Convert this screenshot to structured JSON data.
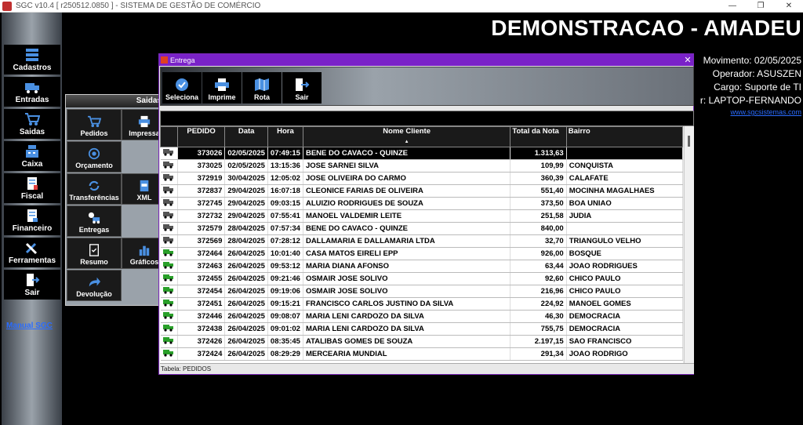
{
  "window": {
    "title": "SGC v10.4 [ r250512.0850 ] - SISTEMA DE GESTÃO DE COMÉRCIO",
    "minimize": "—",
    "maximize": "❐",
    "close": "✕"
  },
  "sidebar": {
    "items": [
      {
        "label": "Cadastros",
        "icon": "server-stack-icon"
      },
      {
        "label": "Entradas",
        "icon": "truck-icon"
      },
      {
        "label": "Saidas",
        "icon": "cart-icon"
      },
      {
        "label": "Caixa",
        "icon": "cash-register-icon"
      },
      {
        "label": "Fiscal",
        "icon": "fiscal-document-icon"
      },
      {
        "label": "Financeiro",
        "icon": "financial-document-icon"
      },
      {
        "label": "Ferramentas",
        "icon": "tools-icon"
      },
      {
        "label": "Sair",
        "icon": "exit-door-icon"
      }
    ],
    "manual_link": "Manual SGC"
  },
  "header": {
    "company": "DEMONSTRACAO - AMADEU",
    "movimento": "Movimento: 02/05/2025",
    "operador": "Operador: ASUSZEN",
    "cargo": "Cargo: Suporte de TI",
    "computador": "r: LAPTOP-FERNANDO",
    "site": "www.sgcsistemas.com"
  },
  "saidas_panel": {
    "title": "Saidas",
    "items": [
      {
        "label": "Pedidos",
        "icon": "cart-icon"
      },
      {
        "label": "Impressa",
        "icon": "printer-icon"
      },
      {
        "label": "Orçamento",
        "icon": "budget-icon"
      },
      {
        "label": "Transferências",
        "icon": "transfer-icon"
      },
      {
        "label": "XML",
        "icon": "xml-icon"
      },
      {
        "label": "Entregas",
        "icon": "delivery-icon"
      },
      {
        "label": "Resumo",
        "icon": "summary-icon"
      },
      {
        "label": "Gráficos",
        "icon": "bar-chart-icon"
      },
      {
        "label": "Devolução",
        "icon": "return-arrow-icon"
      }
    ]
  },
  "dialog": {
    "title": "Entrega",
    "close": "✕",
    "toolbar": [
      {
        "label": "Seleciona",
        "icon": "check-circle-icon"
      },
      {
        "label": "Imprime",
        "icon": "printer-icon"
      },
      {
        "label": "Rota",
        "icon": "map-icon"
      },
      {
        "label": "Sair",
        "icon": "exit-door-icon"
      }
    ],
    "columns": [
      "",
      "PEDIDO",
      "Data",
      "Hora",
      "Nome Cliente",
      "Total da Nota",
      "Bairro"
    ],
    "sort_indicator": "▲",
    "rows": [
      {
        "pedido": "373026",
        "data": "02/05/2025",
        "hora": "07:49:15",
        "cliente": "BENE DO CAVACO - QUINZE",
        "total": "1.313,63",
        "bairro": "",
        "selected": true
      },
      {
        "pedido": "373025",
        "data": "02/05/2025",
        "hora": "13:15:36",
        "cliente": "JOSE SARNEI SILVA",
        "total": "109,99",
        "bairro": "CONQUISTA"
      },
      {
        "pedido": "372919",
        "data": "30/04/2025",
        "hora": "12:05:02",
        "cliente": "JOSE OLIVEIRA DO CARMO",
        "total": "360,39",
        "bairro": "CALAFATE"
      },
      {
        "pedido": "372837",
        "data": "29/04/2025",
        "hora": "16:07:18",
        "cliente": "CLEONICE FARIAS DE OLIVEIRA",
        "total": "551,40",
        "bairro": "MOCINHA MAGALHAES"
      },
      {
        "pedido": "372745",
        "data": "29/04/2025",
        "hora": "09:03:15",
        "cliente": "ALUIZIO RODRIGUES DE SOUZA",
        "total": "373,50",
        "bairro": "BOA UNIAO"
      },
      {
        "pedido": "372732",
        "data": "29/04/2025",
        "hora": "07:55:41",
        "cliente": "MANOEL VALDEMIR LEITE",
        "total": "251,58",
        "bairro": "JUDIA"
      },
      {
        "pedido": "372579",
        "data": "28/04/2025",
        "hora": "07:57:34",
        "cliente": "BENE DO CAVACO - QUINZE",
        "total": "840,00",
        "bairro": ""
      },
      {
        "pedido": "372569",
        "data": "28/04/2025",
        "hora": "07:28:12",
        "cliente": "DALLAMARIA E DALLAMARIA LTDA",
        "total": "32,70",
        "bairro": "TRIANGULO VELHO"
      },
      {
        "pedido": "372464",
        "data": "26/04/2025",
        "hora": "10:01:40",
        "cliente": "CASA MATOS EIRELI EPP",
        "total": "926,00",
        "bairro": "BOSQUE"
      },
      {
        "pedido": "372463",
        "data": "26/04/2025",
        "hora": "09:53:12",
        "cliente": "MARIA DIANA AFONSO",
        "total": "63,44",
        "bairro": "JOAO RODRIGUES"
      },
      {
        "pedido": "372455",
        "data": "26/04/2025",
        "hora": "09:21:46",
        "cliente": "OSMAIR JOSE SOLIVO",
        "total": "92,60",
        "bairro": "CHICO PAULO"
      },
      {
        "pedido": "372454",
        "data": "26/04/2025",
        "hora": "09:19:06",
        "cliente": "OSMAIR JOSE SOLIVO",
        "total": "216,96",
        "bairro": "CHICO PAULO"
      },
      {
        "pedido": "372451",
        "data": "26/04/2025",
        "hora": "09:15:21",
        "cliente": "FRANCISCO CARLOS JUSTINO DA SILVA",
        "total": "224,92",
        "bairro": "MANOEL GOMES"
      },
      {
        "pedido": "372446",
        "data": "26/04/2025",
        "hora": "09:08:07",
        "cliente": "MARIA LENI CARDOZO DA SILVA",
        "total": "46,30",
        "bairro": "DEMOCRACIA"
      },
      {
        "pedido": "372438",
        "data": "26/04/2025",
        "hora": "09:01:02",
        "cliente": "MARIA LENI CARDOZO DA SILVA",
        "total": "755,75",
        "bairro": "DEMOCRACIA"
      },
      {
        "pedido": "372426",
        "data": "26/04/2025",
        "hora": "08:35:45",
        "cliente": "ATALIBAS GOMES DE SOUZA",
        "total": "2.197,15",
        "bairro": "SAO FRANCISCO"
      },
      {
        "pedido": "372424",
        "data": "26/04/2025",
        "hora": "08:29:29",
        "cliente": "MERCEARIA MUNDIAL",
        "total": "291,34",
        "bairro": "JOAO RODRIGO"
      }
    ],
    "status": "Tabela: PEDIDOS"
  },
  "colors": {
    "accent": "#7a22c8",
    "link": "#2a6cff",
    "truck_gray": "#555555",
    "truck_green": "#2aa02a"
  }
}
